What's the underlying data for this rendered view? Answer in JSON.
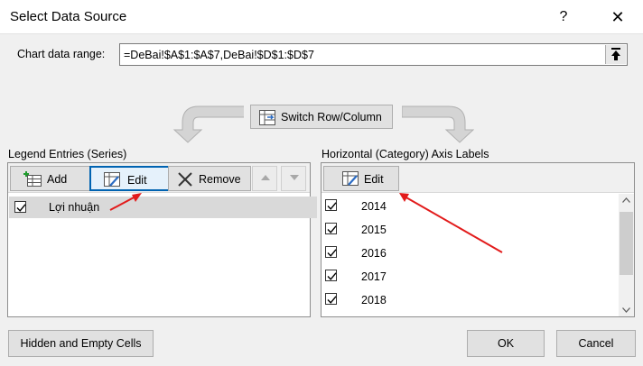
{
  "window": {
    "title": "Select Data Source",
    "help_glyph": "?",
    "close_glyph": "✕"
  },
  "range": {
    "label": "Chart data range:",
    "value": "=DeBai!$A$1:$A$7,DeBai!$D$1:$D$7"
  },
  "switch_label": "Switch Row/Column",
  "legend": {
    "label": "Legend Entries (Series)",
    "add": "Add",
    "edit": "Edit",
    "remove": "Remove",
    "series": [
      {
        "name": "Lợi nhuận",
        "checked": true
      }
    ]
  },
  "category": {
    "label": "Horizontal (Category) Axis Labels",
    "edit": "Edit",
    "items": [
      {
        "label": "2014",
        "checked": true
      },
      {
        "label": "2015",
        "checked": true
      },
      {
        "label": "2016",
        "checked": true
      },
      {
        "label": "2017",
        "checked": true
      },
      {
        "label": "2018",
        "checked": true
      }
    ]
  },
  "buttons": {
    "hidden_empty": "Hidden and Empty Cells",
    "ok": "OK",
    "cancel": "Cancel"
  },
  "colors": {
    "accent": "#0063b1",
    "annotation": "#e21b1b"
  }
}
